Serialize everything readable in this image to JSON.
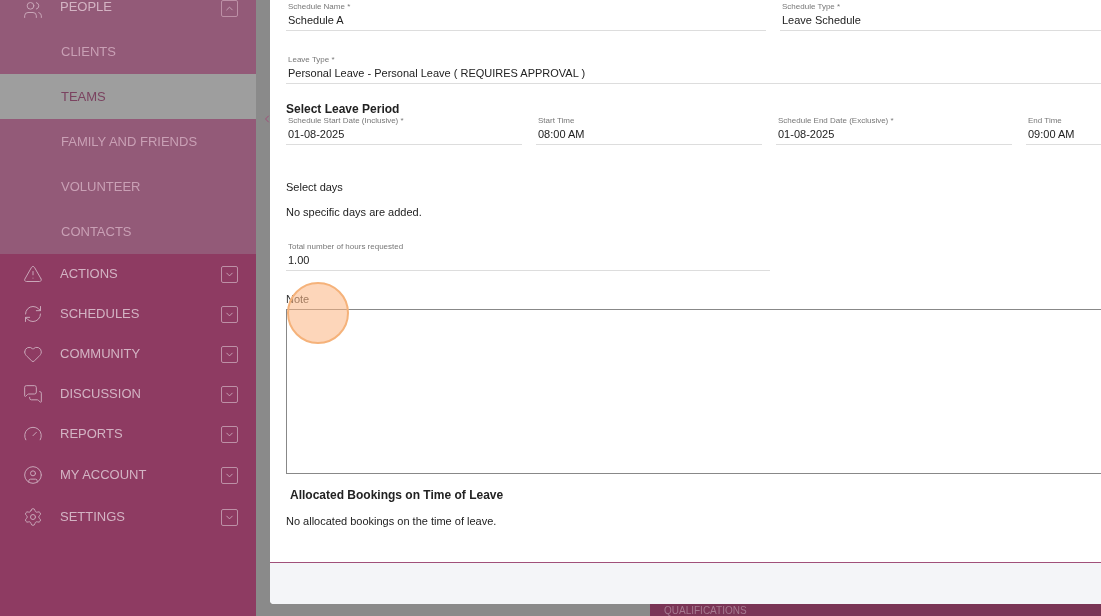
{
  "sidebar": {
    "items": [
      {
        "label": "PEOPLE",
        "expanded": true,
        "children": [
          {
            "label": "CLIENTS",
            "selected": false
          },
          {
            "label": "TEAMS",
            "selected": true
          },
          {
            "label": "FAMILY AND FRIENDS",
            "selected": false
          },
          {
            "label": "VOLUNTEER",
            "selected": false
          },
          {
            "label": "CONTACTS",
            "selected": false
          }
        ]
      },
      {
        "label": "ACTIONS",
        "expanded": false
      },
      {
        "label": "SCHEDULES",
        "expanded": false
      },
      {
        "label": "COMMUNITY",
        "expanded": false
      },
      {
        "label": "DISCUSSION",
        "expanded": false
      },
      {
        "label": "REPORTS",
        "expanded": false
      },
      {
        "label": "MY ACCOUNT",
        "expanded": false
      },
      {
        "label": "SETTINGS",
        "expanded": false
      }
    ]
  },
  "form": {
    "schedule_name": {
      "label": "Schedule Name *",
      "value": "Schedule A"
    },
    "schedule_type": {
      "label": "Schedule Type *",
      "value": "Leave Schedule"
    },
    "leave_type": {
      "label": "Leave Type *",
      "value": "Personal Leave - Personal Leave ( REQUIRES APPROVAL )"
    },
    "leave_period": {
      "heading": "Select Leave Period",
      "fields": [
        {
          "label": "Schedule Start Date (Inclusive) *",
          "value": "01-08-2025"
        },
        {
          "label": "Start Time",
          "value": "08:00 AM"
        },
        {
          "label": "Schedule End Date (Exclusive) *",
          "value": "01-08-2025"
        },
        {
          "label": "End Time",
          "value": "09:00 AM"
        }
      ]
    },
    "select_days": {
      "heading": "Select days",
      "text": "No specific days are added."
    },
    "total_hours": {
      "label": "Total number of hours requested",
      "value": "1.00"
    },
    "note": {
      "label": "Note"
    },
    "allocated": {
      "heading": "Allocated Bookings on Time of Leave",
      "text": "No allocated bookings on the time of leave."
    }
  },
  "background_menu_item": {
    "label": "QUALIFICATIONS"
  }
}
